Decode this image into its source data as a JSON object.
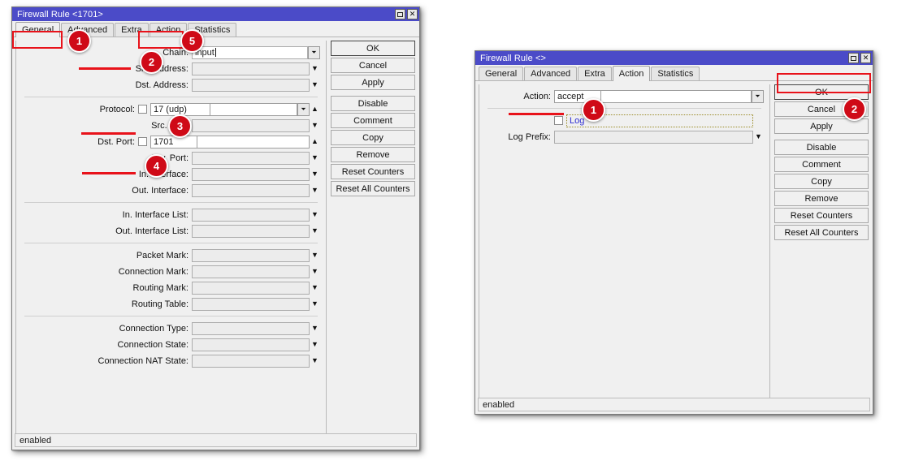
{
  "left_window": {
    "title": "Firewall Rule <1701>",
    "window_buttons": {
      "maximize": "maximize-icon",
      "close": "✕"
    },
    "tabs": [
      {
        "label": "General",
        "active": true
      },
      {
        "label": "Advanced",
        "active": false
      },
      {
        "label": "Extra",
        "active": false
      },
      {
        "label": "Action",
        "active": false
      },
      {
        "label": "Statistics",
        "active": false
      }
    ],
    "fields": {
      "chain": {
        "label": "Chain:",
        "value": "input"
      },
      "src_address": {
        "label": "Src. Address:",
        "value": ""
      },
      "dst_address": {
        "label": "Dst. Address:",
        "value": ""
      },
      "protocol": {
        "label": "Protocol:",
        "value": "17 (udp)"
      },
      "src_port": {
        "label": "Src. Port:",
        "value": ""
      },
      "dst_port": {
        "label": "Dst. Port:",
        "value": "1701"
      },
      "any_port": {
        "label": "Any. Port:",
        "value": ""
      },
      "in_interface": {
        "label": "In. Interface:",
        "value": ""
      },
      "out_interface": {
        "label": "Out. Interface:",
        "value": ""
      },
      "in_interface_list": {
        "label": "In. Interface List:",
        "value": ""
      },
      "out_interface_list": {
        "label": "Out. Interface List:",
        "value": ""
      },
      "packet_mark": {
        "label": "Packet Mark:",
        "value": ""
      },
      "connection_mark": {
        "label": "Connection Mark:",
        "value": ""
      },
      "routing_mark": {
        "label": "Routing Mark:",
        "value": ""
      },
      "routing_table": {
        "label": "Routing Table:",
        "value": ""
      },
      "connection_type": {
        "label": "Connection Type:",
        "value": ""
      },
      "connection_state": {
        "label": "Connection State:",
        "value": ""
      },
      "connection_nat_state": {
        "label": "Connection NAT State:",
        "value": ""
      }
    },
    "buttons": [
      "OK",
      "Cancel",
      "Apply",
      "Disable",
      "Comment",
      "Copy",
      "Remove",
      "Reset Counters",
      "Reset All Counters"
    ],
    "status": "enabled",
    "callouts": [
      {
        "number": "1"
      },
      {
        "number": "2"
      },
      {
        "number": "3"
      },
      {
        "number": "4"
      },
      {
        "number": "5"
      }
    ]
  },
  "right_window": {
    "title": "Firewall Rule <>",
    "window_buttons": {
      "maximize": "maximize-icon",
      "close": "✕"
    },
    "tabs": [
      {
        "label": "General",
        "active": false
      },
      {
        "label": "Advanced",
        "active": false
      },
      {
        "label": "Extra",
        "active": false
      },
      {
        "label": "Action",
        "active": true
      },
      {
        "label": "Statistics",
        "active": false
      }
    ],
    "fields": {
      "action": {
        "label": "Action:",
        "value": "accept"
      },
      "log": {
        "label": "Log",
        "checked": false
      },
      "log_prefix": {
        "label": "Log Prefix:",
        "value": ""
      }
    },
    "buttons": [
      "OK",
      "Cancel",
      "Apply",
      "Disable",
      "Comment",
      "Copy",
      "Remove",
      "Reset Counters",
      "Reset All Counters"
    ],
    "status": "enabled",
    "callouts": [
      {
        "number": "1"
      },
      {
        "number": "2"
      }
    ]
  },
  "colors": {
    "titlebar": "#4b4bc8",
    "annotation_red": "#e8121a",
    "bubble_red": "#cf0a17",
    "panel_gray": "#f0f0f0",
    "log_link": "#2a2ad0"
  }
}
